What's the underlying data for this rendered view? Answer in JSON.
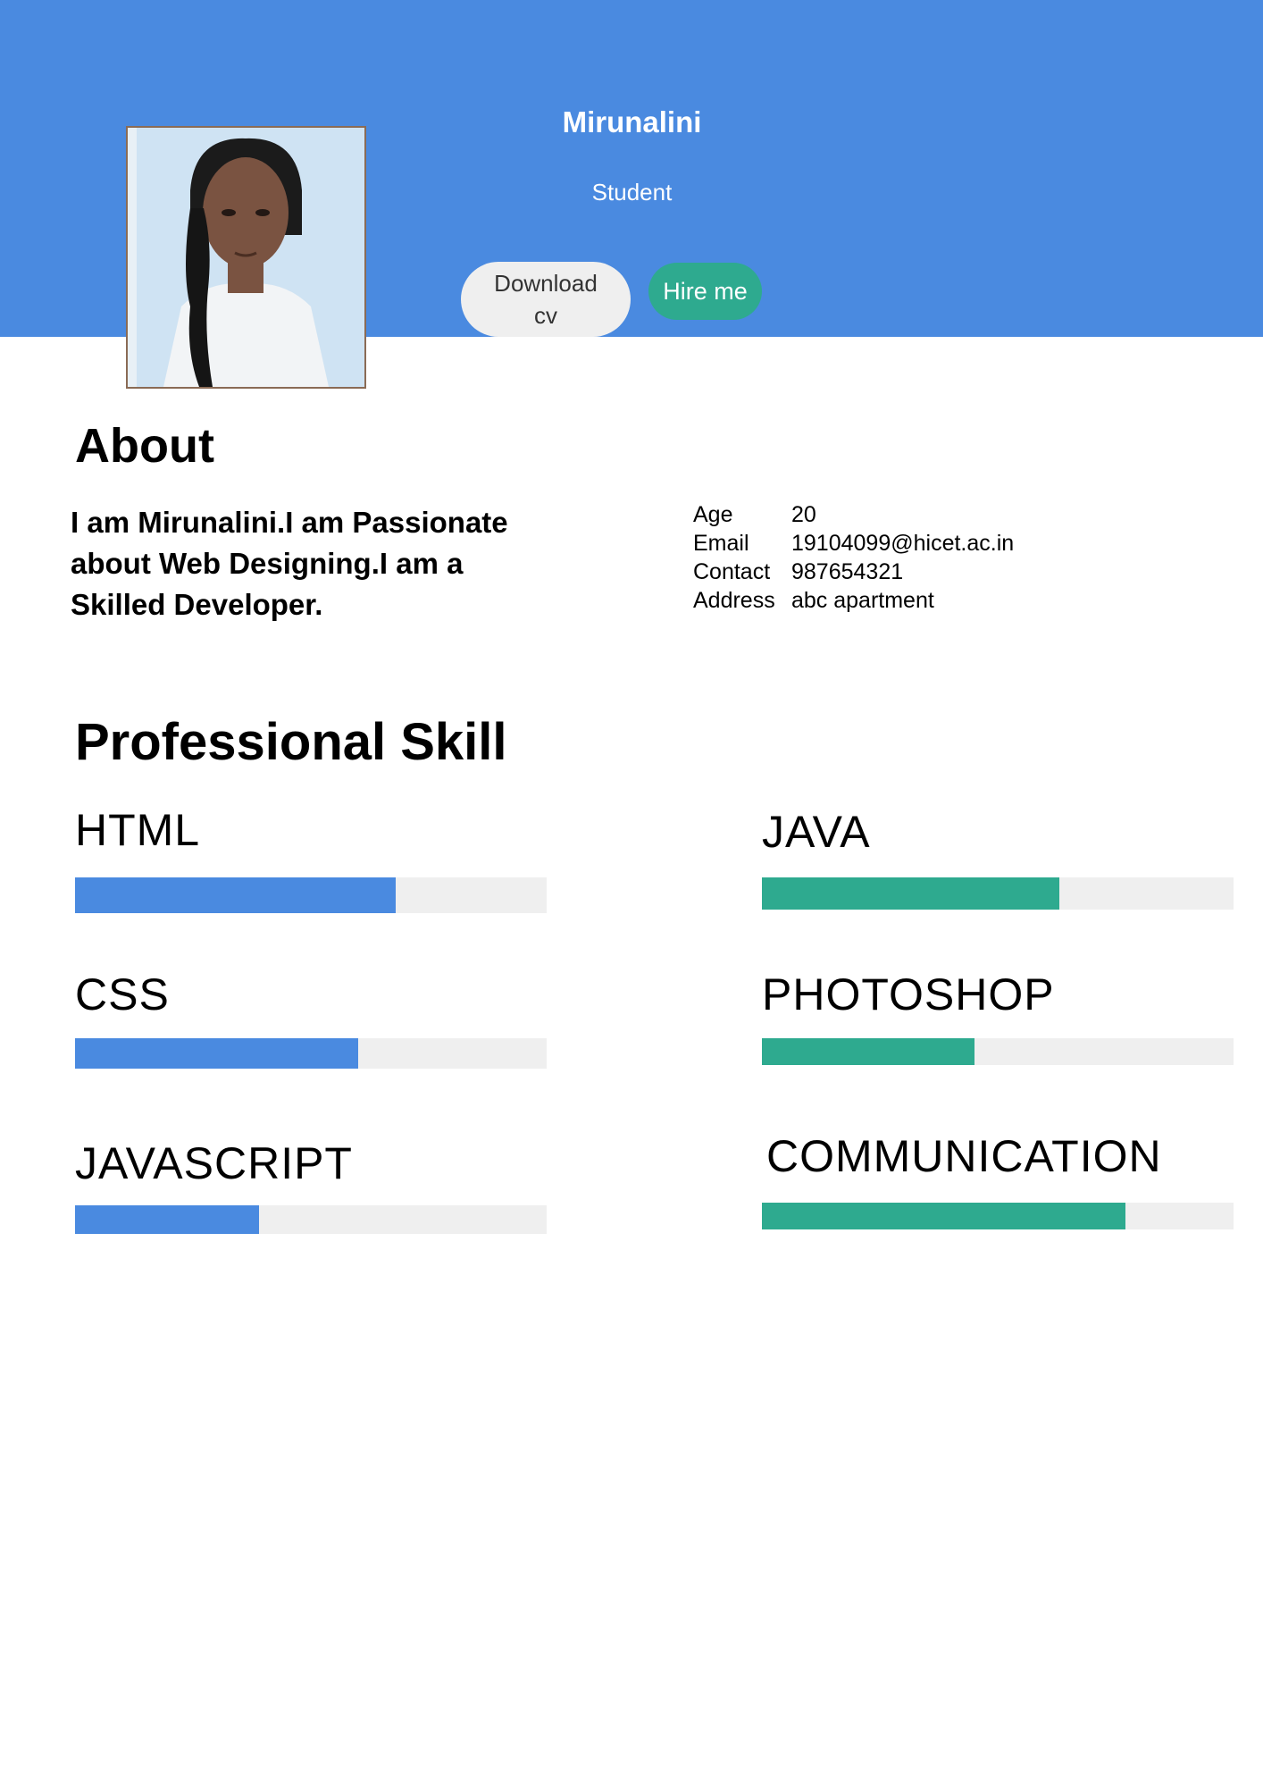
{
  "header": {
    "name": "Mirunalini",
    "role": "Student",
    "download_label": "Download cv",
    "hire_label": "Hire me"
  },
  "about": {
    "title": "About",
    "text": "I am Mirunalini.I am Passionate about Web Designing.I am a Skilled Developer.",
    "info": [
      {
        "label": "Age",
        "value": "20"
      },
      {
        "label": "Email",
        "value": "19104099@hicet.ac.in"
      },
      {
        "label": "Contact",
        "value": "987654321"
      },
      {
        "label": "Address",
        "value": "abc apartment"
      }
    ]
  },
  "skills": {
    "title": "Professional Skill",
    "items": [
      {
        "name": "HTML",
        "level": 0.68
      },
      {
        "name": "JAVA",
        "level": 0.63
      },
      {
        "name": "CSS",
        "level": 0.6
      },
      {
        "name": "PHOTOSHOP",
        "level": 0.45
      },
      {
        "name": "JAVASCRIPT",
        "level": 0.39
      },
      {
        "name": "COMMUNICATION",
        "level": 0.77
      }
    ]
  },
  "colors": {
    "header_bg": "#4a8ae0",
    "accent_green": "#2eaa8f",
    "bar_track": "#efefef"
  }
}
